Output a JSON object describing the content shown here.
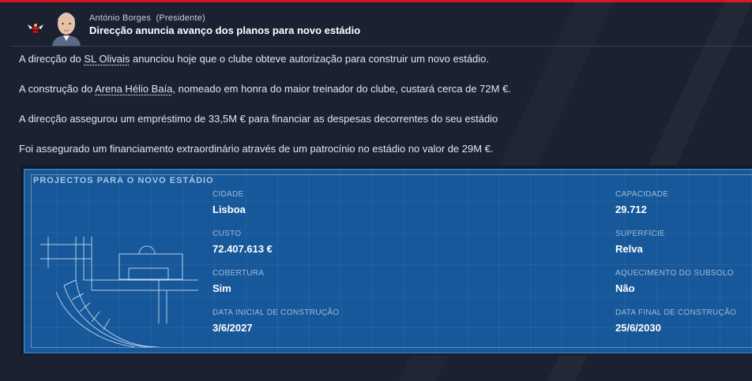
{
  "header": {
    "sender_name": "António Borges",
    "sender_role": "(Presidente)",
    "subject": "Direcção anuncia avanço dos planos para novo estádio",
    "crest_icon": "club-crest-icon",
    "avatar_icon": "person-avatar-icon"
  },
  "body": {
    "p1": {
      "before": "A direcção do ",
      "link": "SL Olivais",
      "after": " anunciou hoje que o clube obteve autorização para construir um novo estádio."
    },
    "p2": {
      "before": "A construção do ",
      "link": "Arena Hélio Baía",
      "after": ", nomeado em honra do maior treinador do clube, custará cerca de 72M €."
    },
    "p3": "A direcção assegurou um empréstimo de 33,5M € para financiar as despesas decorrentes do seu estádio",
    "p4": "Foi assegurado um financiamento extraordinário através de um patrocínio no estádio no valor de 29M €."
  },
  "project": {
    "title": "PROJECTOS PARA O NOVO ESTÁDIO",
    "cidade_label": "CIDADE",
    "cidade_value": "Lisboa",
    "capacidade_label": "CAPACIDADE",
    "capacidade_value": "29.712",
    "custo_label": "CUSTO",
    "custo_value": "72.407.613 €",
    "superficie_label": "SUPERFÍCIE",
    "superficie_value": "Relva",
    "cobertura_label": "COBERTURA",
    "cobertura_value": "Sim",
    "aquecimento_label": "AQUECIMENTO DO SUBSOLO",
    "aquecimento_value": "Não",
    "data_inicial_label": "DATA INICIAL DE CONSTRUÇÃO",
    "data_inicial_value": "3/6/2027",
    "data_final_label": "DATA FINAL DE CONSTRUÇÃO",
    "data_final_value": "25/6/2030"
  },
  "colors": {
    "accent": "#d8141f",
    "blueprint": "#17589a",
    "background": "#1b2130"
  }
}
